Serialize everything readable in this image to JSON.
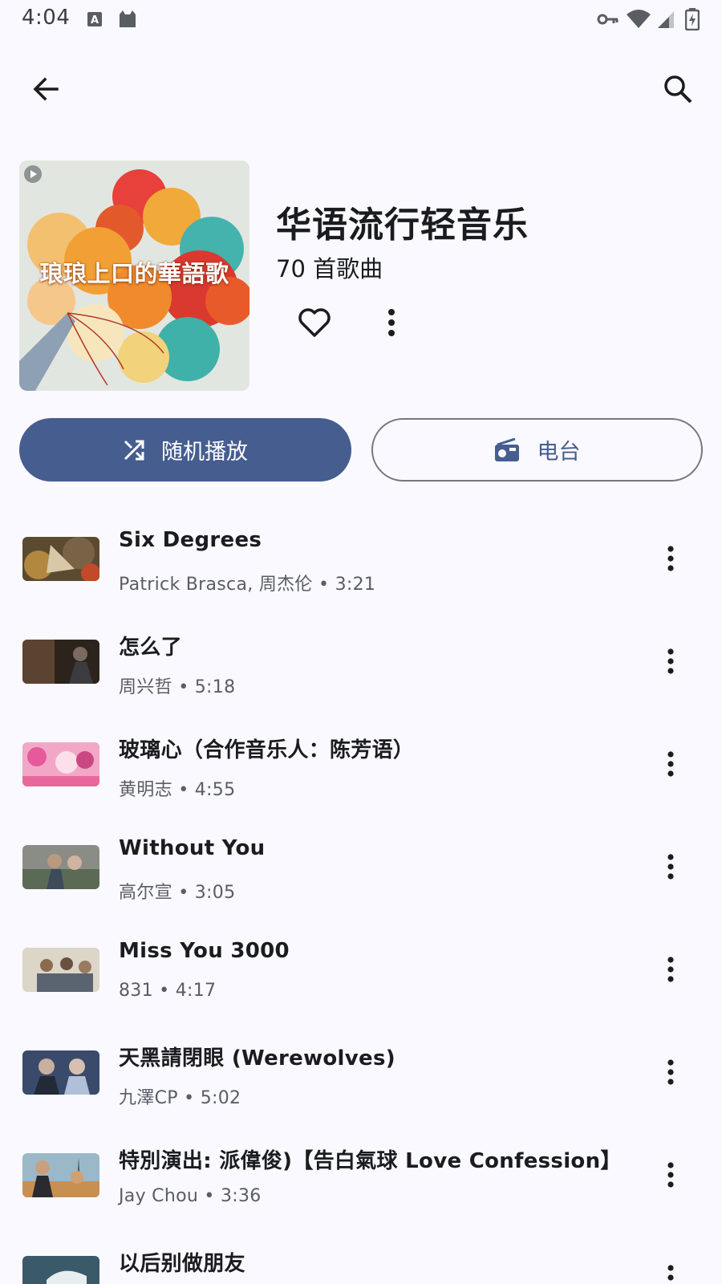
{
  "status_bar": {
    "time": "4:04"
  },
  "app_bar": {
    "back_icon": "arrow-left-icon",
    "search_icon": "search-icon"
  },
  "playlist": {
    "cover_text": "琅琅上口的華語歌",
    "title": "华语流行轻音乐",
    "song_count": "70 首歌曲"
  },
  "actions": {
    "shuffle_label": "随机播放",
    "radio_label": "电台"
  },
  "colors": {
    "accent": "#465d8f",
    "background": "#f9f9ff"
  },
  "songs": [
    {
      "title": "Six Degrees",
      "subtitle": "Patrick Brasca, 周杰伦 • 3:21"
    },
    {
      "title": "怎么了",
      "subtitle": "周兴哲 • 5:18"
    },
    {
      "title": "玻璃心（合作音乐人：陈芳语）",
      "subtitle": "黄明志 • 4:55"
    },
    {
      "title": "Without You",
      "subtitle": "高尔宣 • 3:05"
    },
    {
      "title": "Miss You 3000",
      "subtitle": "831 • 4:17"
    },
    {
      "title": "天黑請閉眼 (Werewolves)",
      "subtitle": "九澤CP • 5:02"
    },
    {
      "title": "特別演出: 派偉俊)【告白氣球 Love Confession】",
      "subtitle": "Jay Chou • 3:36"
    },
    {
      "title": "以后别做朋友",
      "subtitle": ""
    }
  ]
}
